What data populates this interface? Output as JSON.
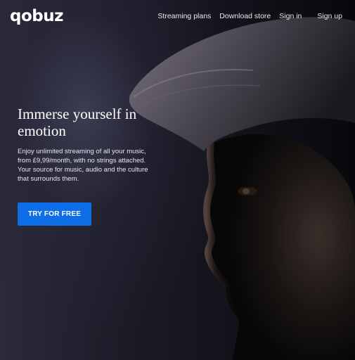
{
  "brand": {
    "logo_text": "qobuz"
  },
  "nav": {
    "items": [
      {
        "label": "Streaming plans"
      },
      {
        "label": "Download store"
      },
      {
        "label": "Sign in"
      },
      {
        "label": "Sign up"
      }
    ]
  },
  "hero": {
    "headline": "Immerse yourself in emotion",
    "description": "Enjoy unlimited streaming of all your music, from £9,99/month, with no strings attached. Your source for music, audio and the culture that surrounds them.",
    "cta_label": "TRY FOR FREE",
    "image_subject": "portrait of a man in a knit cap, face in profile, dark background"
  },
  "colors": {
    "background": "#0b0b10",
    "accent": "#0d6ee8",
    "text": "#ffffff"
  }
}
